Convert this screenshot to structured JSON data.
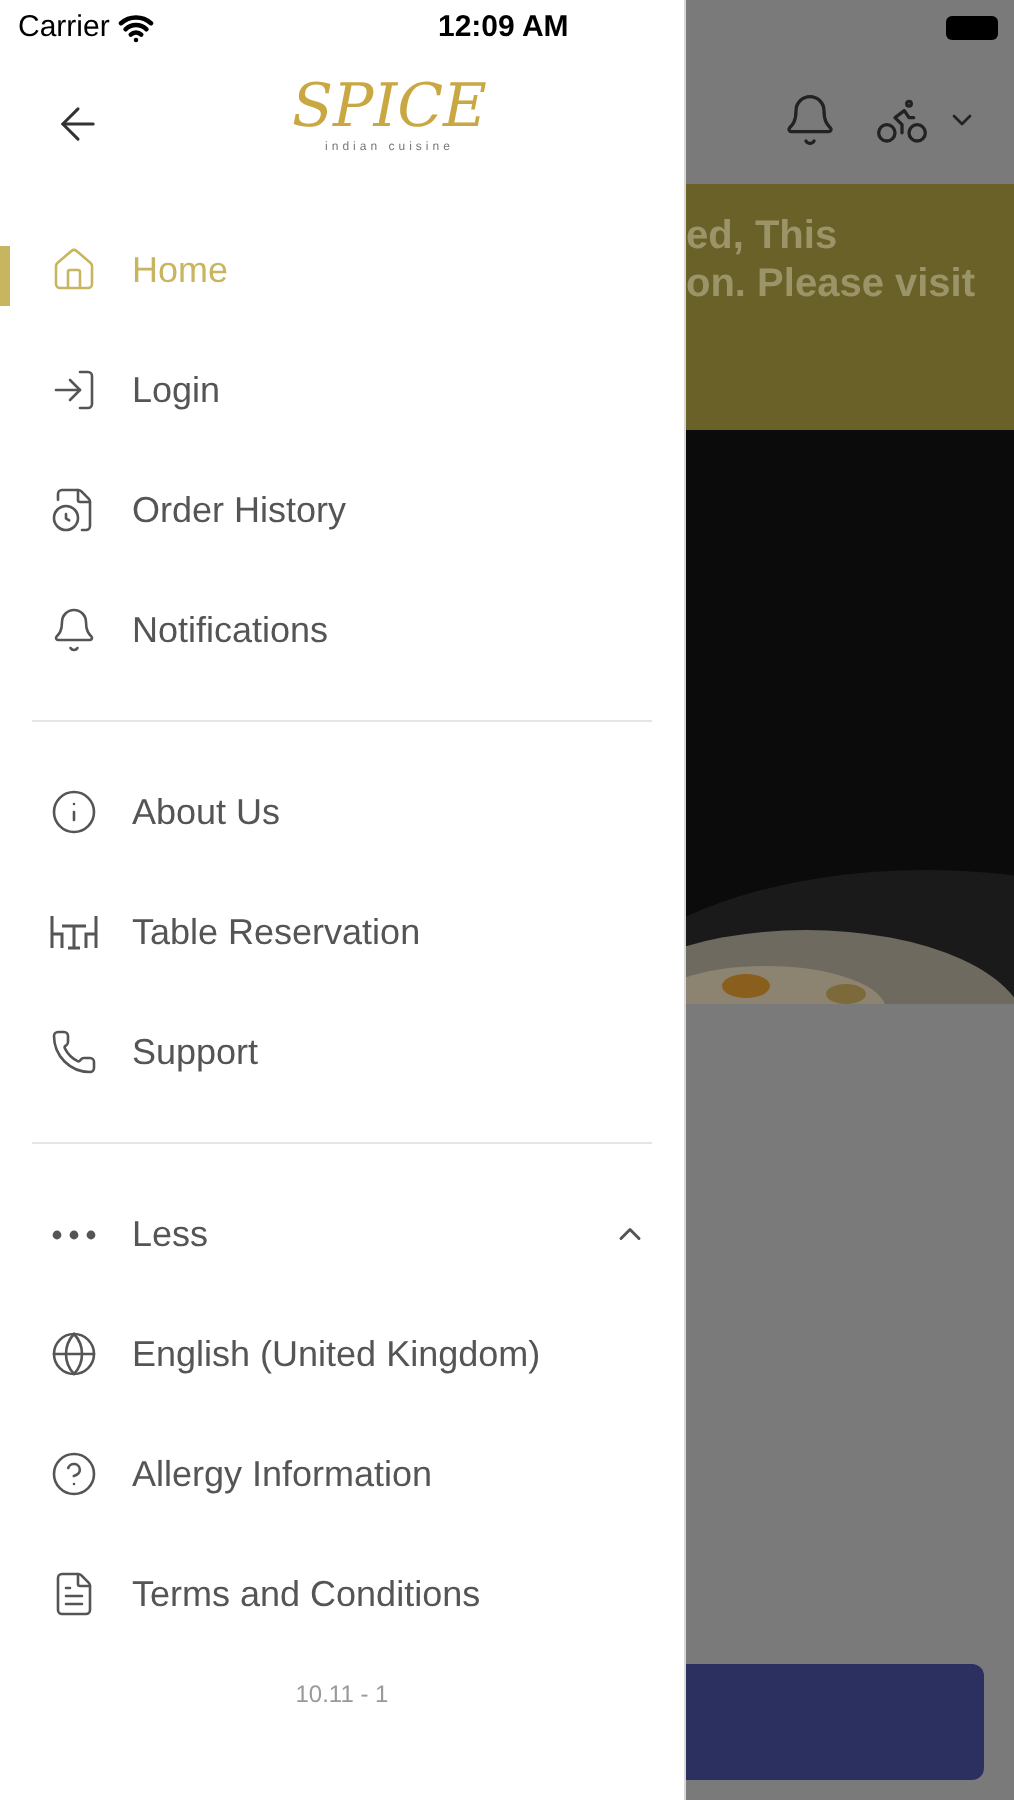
{
  "status_bar": {
    "carrier": "Carrier",
    "time": "12:09 AM"
  },
  "drawer": {
    "logo": {
      "title": "SPICE",
      "subtitle": "indian cuisine"
    },
    "sections": [
      {
        "items": [
          {
            "label": "Home",
            "selected": true
          },
          {
            "label": "Login",
            "selected": false
          },
          {
            "label": "Order History",
            "selected": false
          },
          {
            "label": "Notifications",
            "selected": false
          }
        ]
      },
      {
        "items": [
          {
            "label": "About Us",
            "selected": false
          },
          {
            "label": "Table Reservation",
            "selected": false
          },
          {
            "label": "Support",
            "selected": false
          }
        ]
      }
    ],
    "more": {
      "label": "Less",
      "expanded": true,
      "items": [
        {
          "label": "English (United Kingdom)",
          "selected": false
        },
        {
          "label": "Allergy Information",
          "selected": false
        },
        {
          "label": "Terms and Conditions",
          "selected": false
        }
      ]
    },
    "version": "10.11 - 1"
  },
  "background": {
    "banner_lines": [
      "ed, This",
      "on. Please visit"
    ]
  }
}
